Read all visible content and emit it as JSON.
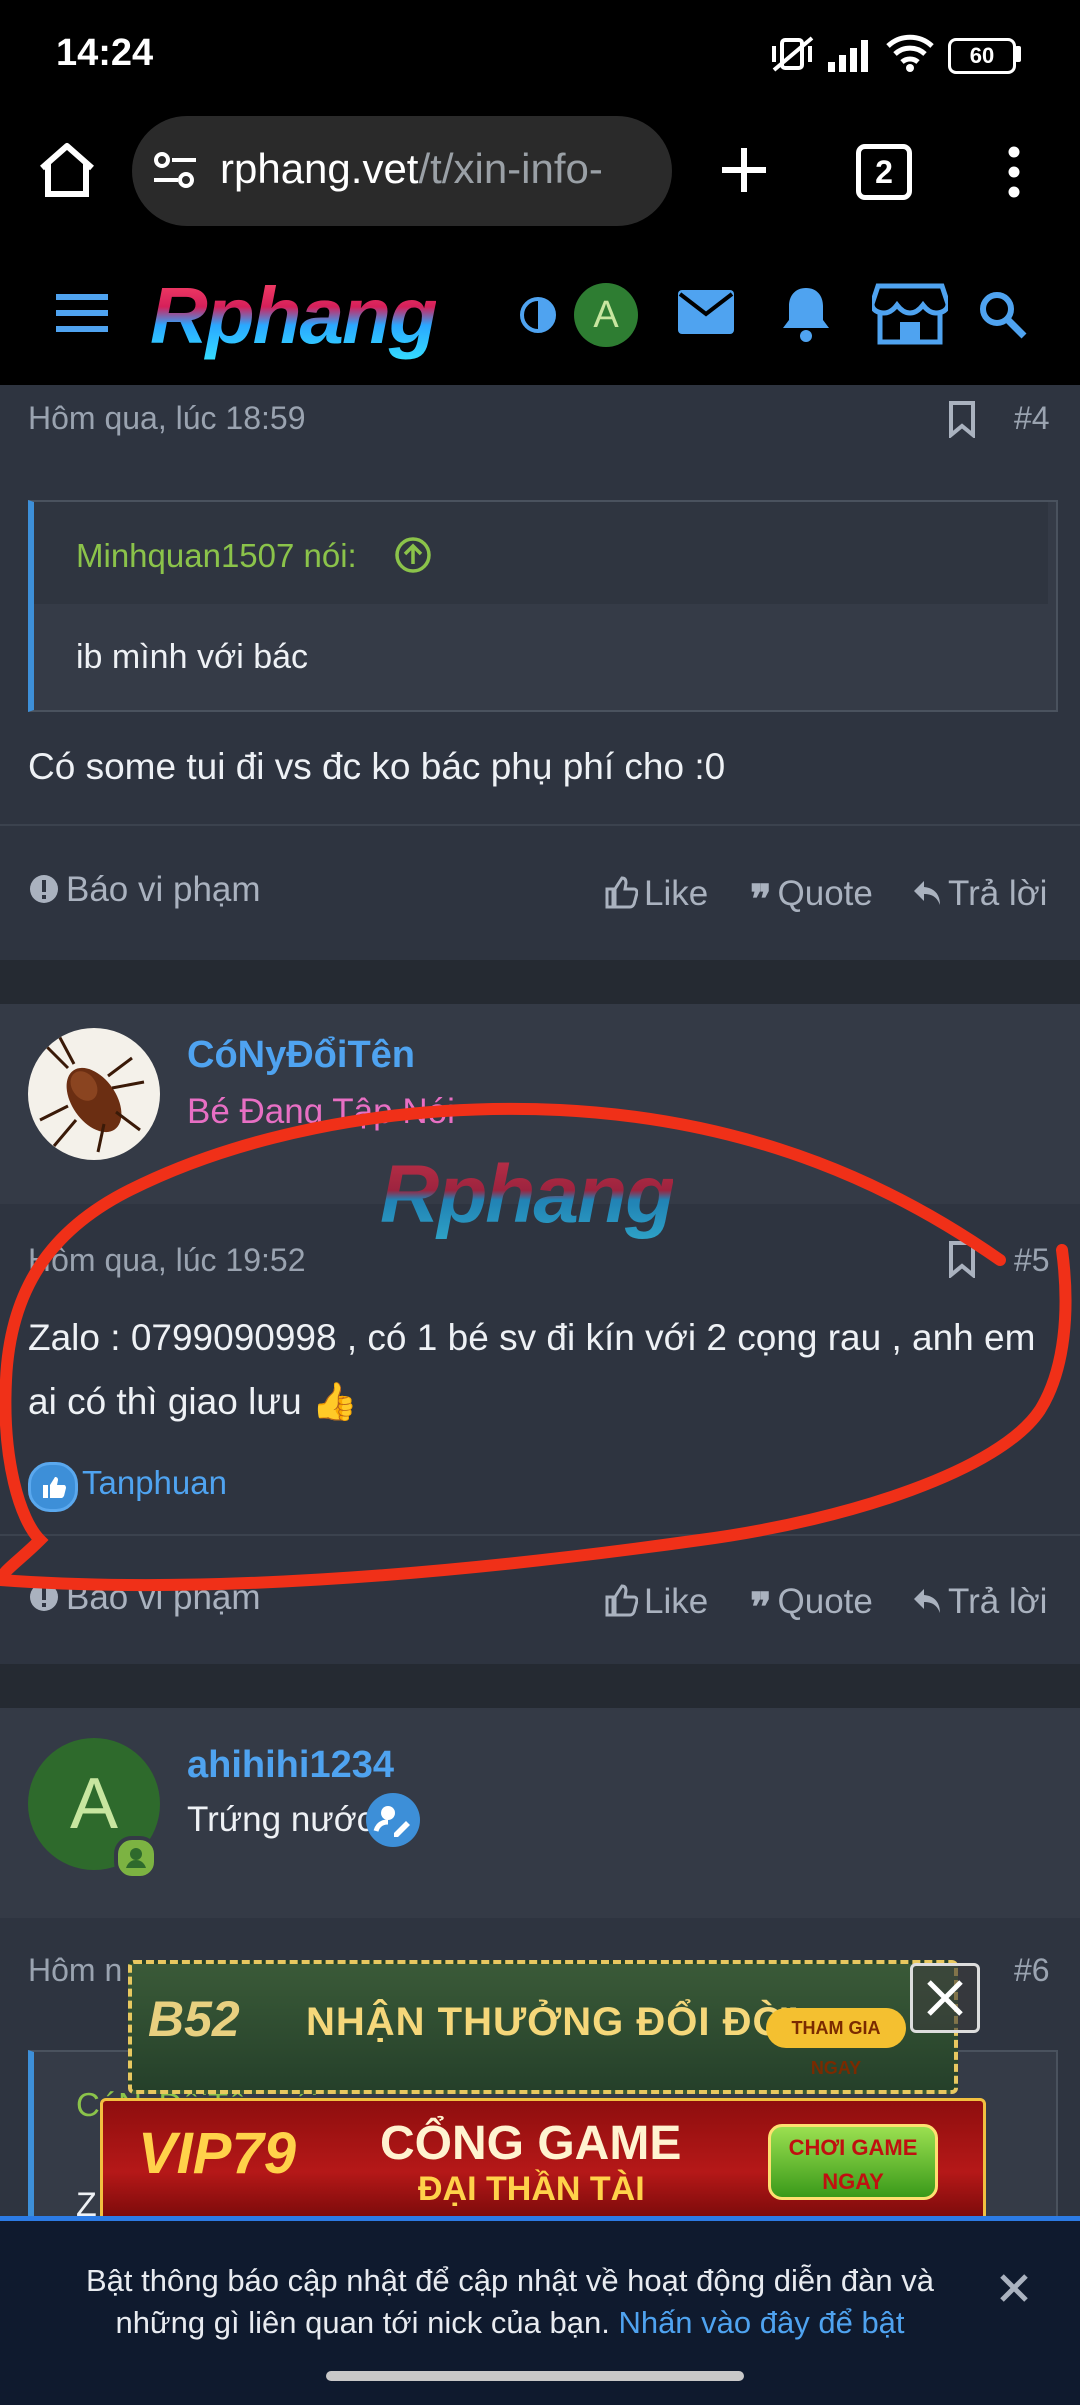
{
  "status_bar": {
    "time": "14:24",
    "battery": "60"
  },
  "browser": {
    "url_host": "rphang.vet",
    "url_path": "/t/xin-info-",
    "tab_count": "2"
  },
  "site": {
    "logo": "Rphang",
    "avatar_letter": "A"
  },
  "post4": {
    "timestamp": "Hôm qua, lúc 18:59",
    "number": "#4",
    "quote_author": "Minhquan1507 nói:",
    "quote_text": "ib mình với bác",
    "body": "Có some tui đi vs đc ko bác phụ phí cho :0",
    "report": "Báo vi phạm",
    "like": "Like",
    "quote": "Quote",
    "reply": "Trả lời"
  },
  "post5": {
    "username": "CóNyĐổiTên",
    "user_title": "Bé Đang Tập Nói",
    "watermark": "Rphang",
    "timestamp": "Hôm qua, lúc 19:52",
    "number": "#5",
    "body_line1": "Zalo : 0799090998 , có 1 bé sv đi kín với 2 cọng rau , anh em",
    "body_line2": "ai có thì giao lưu 👍",
    "liked_by": "Tanphuan",
    "report": "Báo vi phạm",
    "like": "Like",
    "quote": "Quote",
    "reply": "Trả lời"
  },
  "post6": {
    "username": "ahihihi1234",
    "avatar_letter": "A",
    "user_title": "Trứng nước",
    "timestamp": "Hôm n",
    "number": "#6",
    "quote_partial": "CóNyĐổiTên nói:",
    "body_partial": "Z"
  },
  "ads": {
    "b52_brand": "B52",
    "b52_text": "NHẬN THƯỞNG ĐỔI ĐỜI",
    "b52_button": "THAM GIA NGAY",
    "vip_brand": "VIP79",
    "vip_line1": "CỔNG GAME",
    "vip_line2": "ĐẠI THẦN TÀI",
    "vip_button": "CHƠI GAME NGAY"
  },
  "notification": {
    "text": "Bật thông báo cập nhật để cập nhật về hoạt động diễn đàn và những gì liên quan tới nick của bạn.",
    "link": "Nhấn vào đây để bật"
  },
  "colors": {
    "accent": "#4fa3f0",
    "quote_author": "#8bc34a",
    "user_title_pink": "#e86fc4",
    "annotation": "#f03018"
  }
}
